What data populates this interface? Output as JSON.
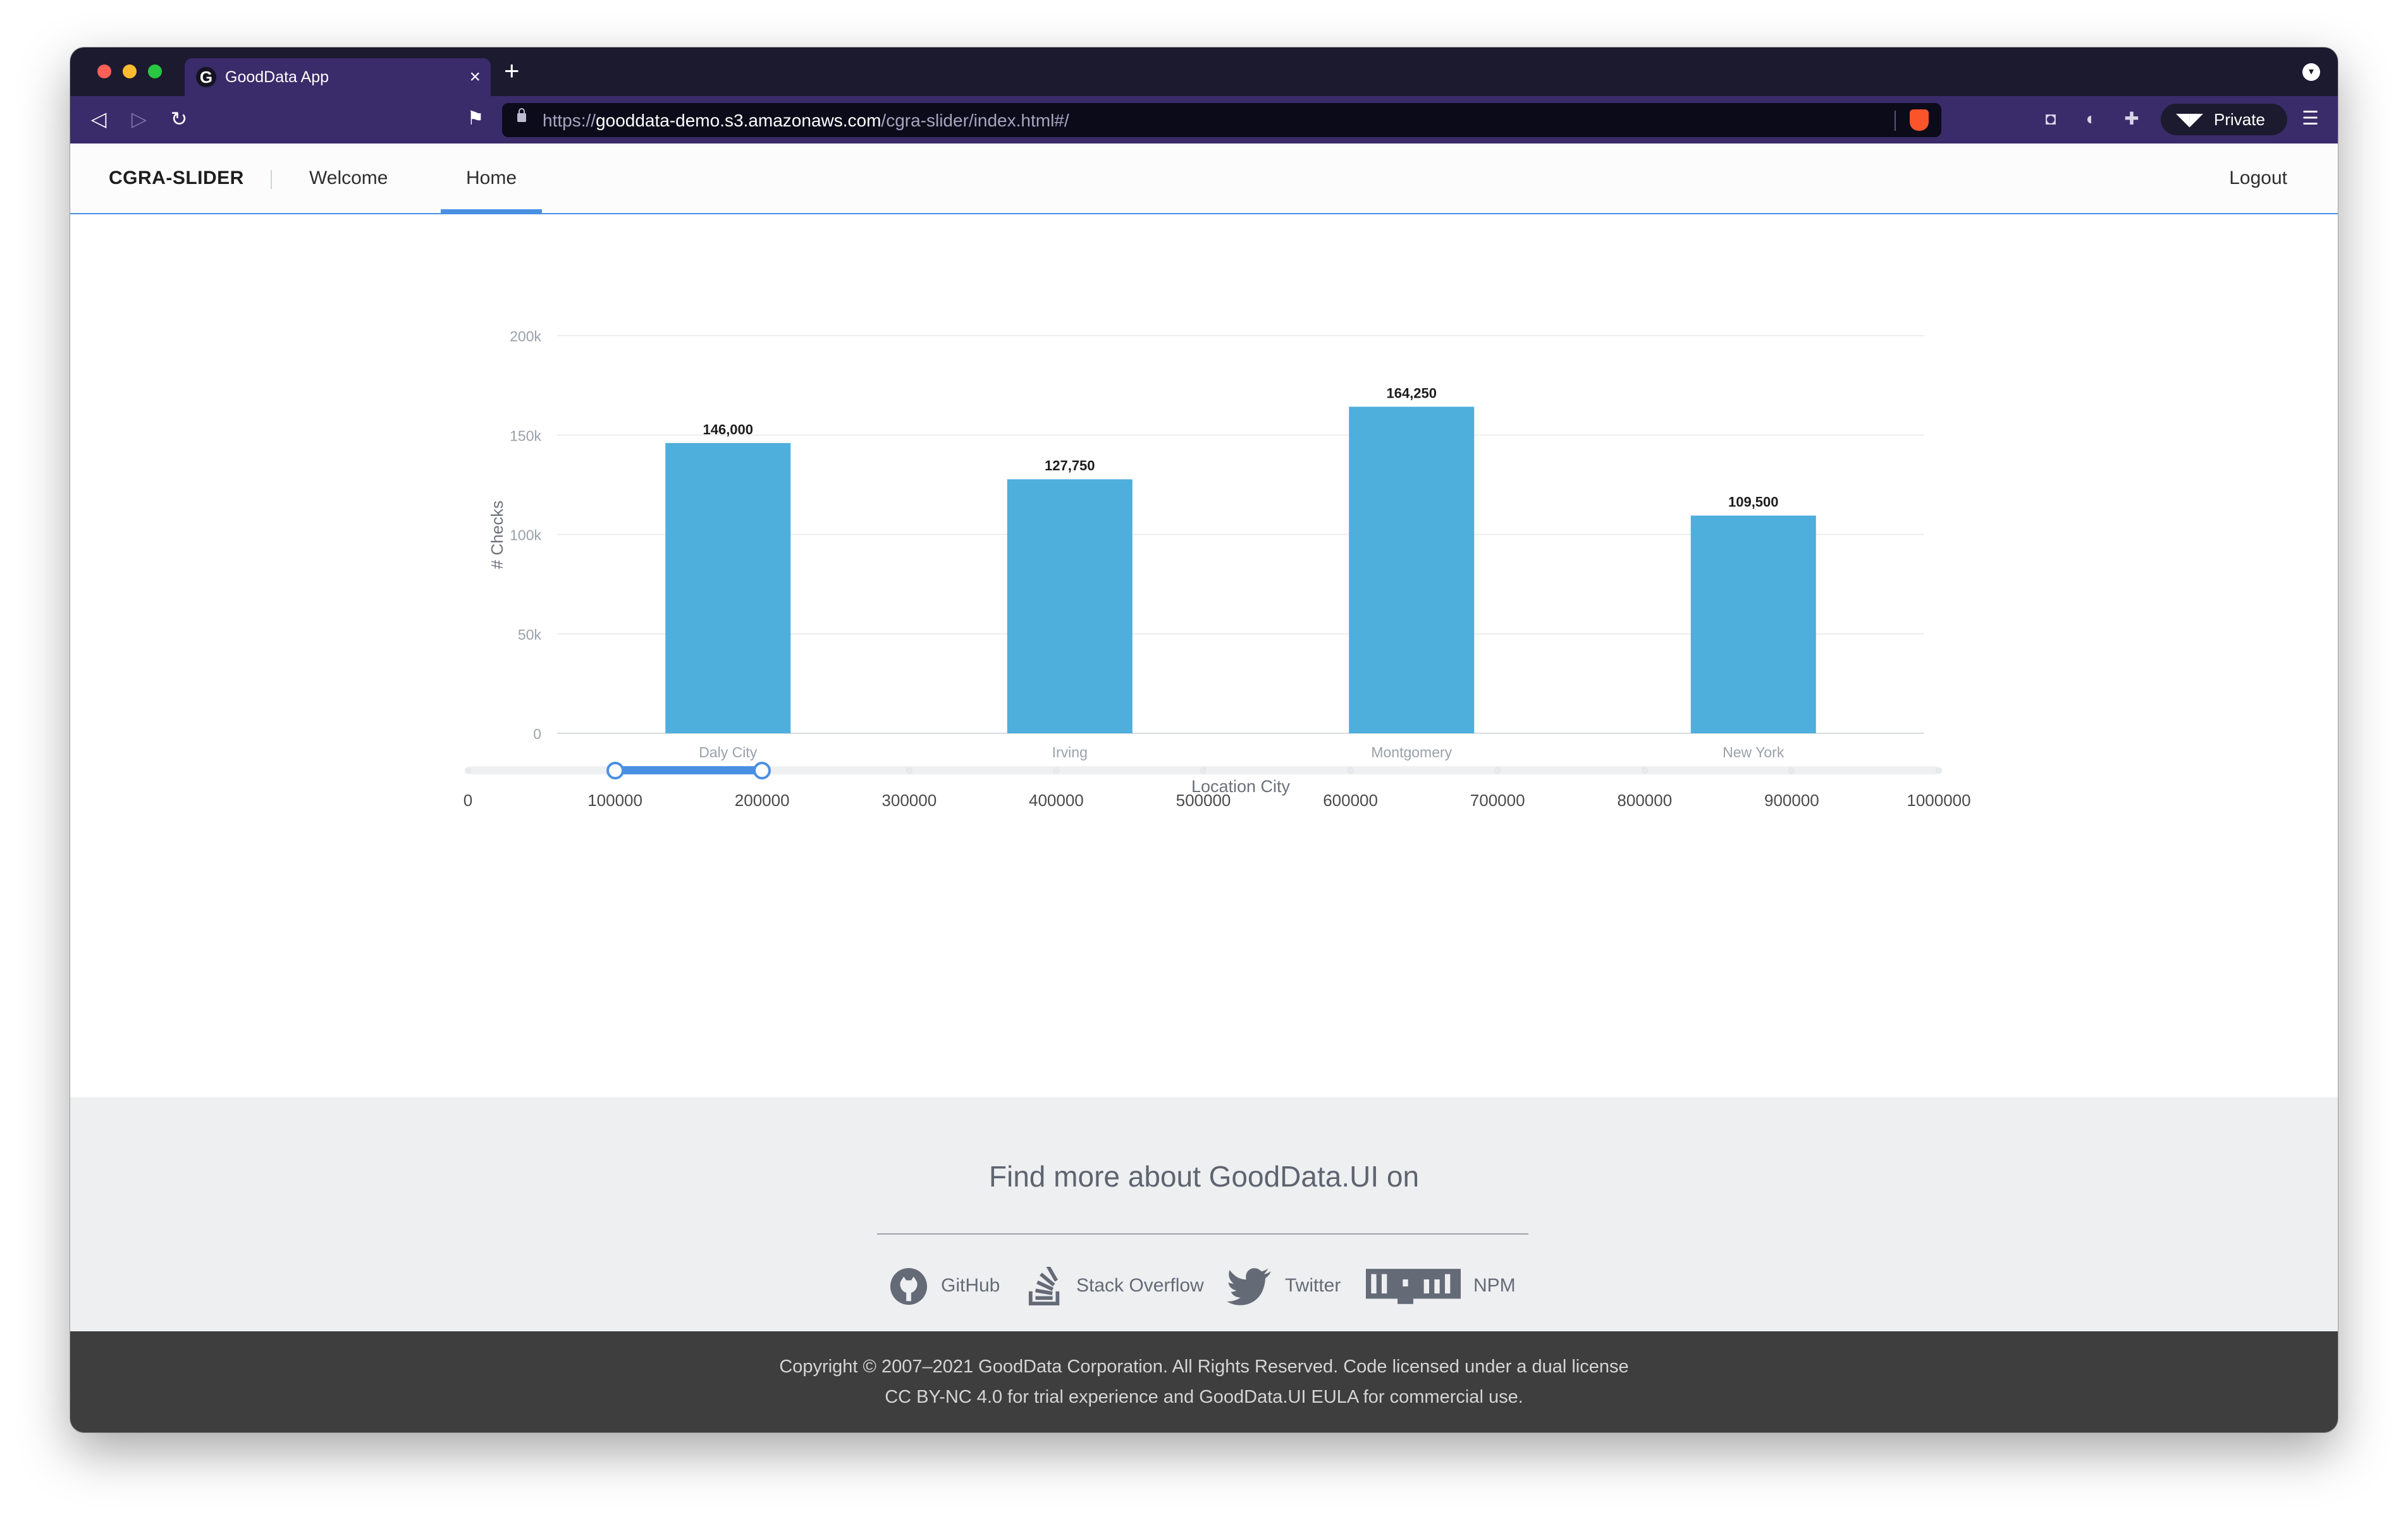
{
  "browser": {
    "tab_title": "GoodData App",
    "new_tab": "+",
    "close": "×",
    "url_scheme": "https://",
    "url_host": "gooddata-demo.s3.amazonaws.com",
    "url_path": "/cgra-slider/index.html#/",
    "private_label": "Private"
  },
  "header": {
    "brand": "CGRA-SLIDER",
    "nav": [
      {
        "label": "Welcome",
        "active": false
      },
      {
        "label": "Home",
        "active": true
      }
    ],
    "logout": "Logout"
  },
  "chart_data": {
    "type": "bar",
    "categories": [
      "Daly City",
      "Irving",
      "Montgomery",
      "New York"
    ],
    "values": [
      146000,
      127750,
      164250,
      109500
    ],
    "data_labels": [
      "146,000",
      "127,750",
      "164,250",
      "109,500"
    ],
    "xlabel": "Location City",
    "ylabel": "# Checks",
    "ylim": [
      0,
      200000
    ],
    "yticks": [
      0,
      50000,
      100000,
      150000,
      200000
    ],
    "ytick_labels": [
      "0",
      "50k",
      "100k",
      "150k",
      "200k"
    ],
    "grid": true,
    "bar_color": "#4eaedc"
  },
  "slider": {
    "min": 0,
    "max": 1000000,
    "range": [
      100000,
      200000
    ],
    "marks": [
      "0",
      "100000",
      "200000",
      "300000",
      "400000",
      "500000",
      "600000",
      "700000",
      "800000",
      "900000",
      "1000000"
    ],
    "accent": "#4a90e2"
  },
  "footer": {
    "heading": "Find more about GoodData.UI on",
    "links": [
      {
        "label": "GitHub",
        "icon": "github-icon"
      },
      {
        "label": "Stack Overflow",
        "icon": "stackoverflow-icon"
      },
      {
        "label": "Twitter",
        "icon": "twitter-icon"
      },
      {
        "label": "NPM",
        "icon": "npm-icon"
      }
    ],
    "copyright_line1": "Copyright © 2007–2021 GoodData Corporation. All Rights Reserved. Code licensed under a dual license",
    "copyright_line2": "CC BY-NC 4.0 for trial experience and GoodData.UI EULA for commercial use."
  }
}
